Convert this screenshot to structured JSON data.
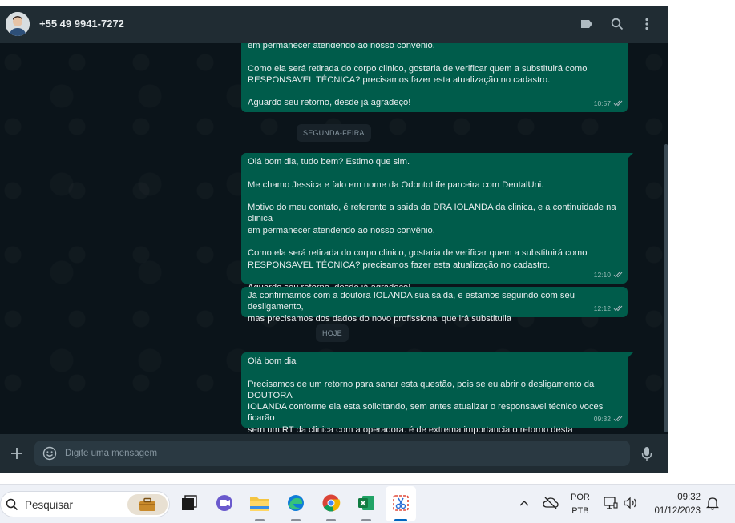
{
  "chat": {
    "contact_name": "+55 49 9941-7272",
    "header_icons": [
      "label-icon",
      "search-icon",
      "more-vert-icon"
    ],
    "dates": {
      "monday": "SEGUNDA-FEIRA",
      "today": "HOJE"
    },
    "messages": [
      {
        "text": "em permanecer atendendo ao nosso convênio.\n\nComo ela será retirada do corpo clinico, gostaria de verificar quem a substituirá como\nRESPONSAVEL TÉCNICA? precisamos fazer esta atualização no cadastro.\n\nAguardo seu retorno, desde já agradeço!",
        "time": "10:57"
      },
      {
        "text": "Olá bom dia, tudo bem? Estimo que sim.\n\nMe chamo Jessica e falo em nome da OdontoLife parceira com DentalUni.\n\nMotivo do meu contato, é referente a saida da DRA IOLANDA da clinica, e a continuidade na clinica\nem permanecer atendendo ao nosso convênio.\n\nComo ela será retirada do corpo clinico, gostaria de verificar quem a substituirá como\nRESPONSAVEL TÉCNICA? precisamos fazer esta atualização no cadastro.\n\nAguardo seu retorno, desde já agradeço!",
        "time": "12:10"
      },
      {
        "text": "Já confirmamos com a doutora IOLANDA sua saida, e estamos seguindo com seu desligamento,\nmas precisamos dos dados do novo profissional que irá substituila",
        "time": "12:12"
      },
      {
        "text": "Olá bom dia\n\nPrecisamos de um retorno para sanar esta questão, pois se eu abrir o desligamento da DOUTORA\nIOLANDA conforme ela esta solicitando, sem antes atualizar o responsavel técnico voces ficarão\nsem um RT da clinica com a operadora. é de extrema importancia o retorno desta mensagem, por\ngentileza.",
        "time": "09:32"
      }
    ],
    "composer": {
      "placeholder": "Digite uma mensagem"
    }
  },
  "taskbar": {
    "search_label": "Pesquisar",
    "apps": [
      "briefcase-icon",
      "task-view-icon",
      "teams-icon",
      "file-explorer-icon",
      "edge-icon",
      "chrome-icon",
      "excel-icon",
      "snipping-tool-icon"
    ],
    "lang_line1": "POR",
    "lang_line2": "PTB",
    "time": "09:32",
    "date": "01/12/2023"
  },
  "colors": {
    "bubble_out": "#005c4b",
    "chat_bg": "#0b141a",
    "header_bg": "#202c33"
  }
}
